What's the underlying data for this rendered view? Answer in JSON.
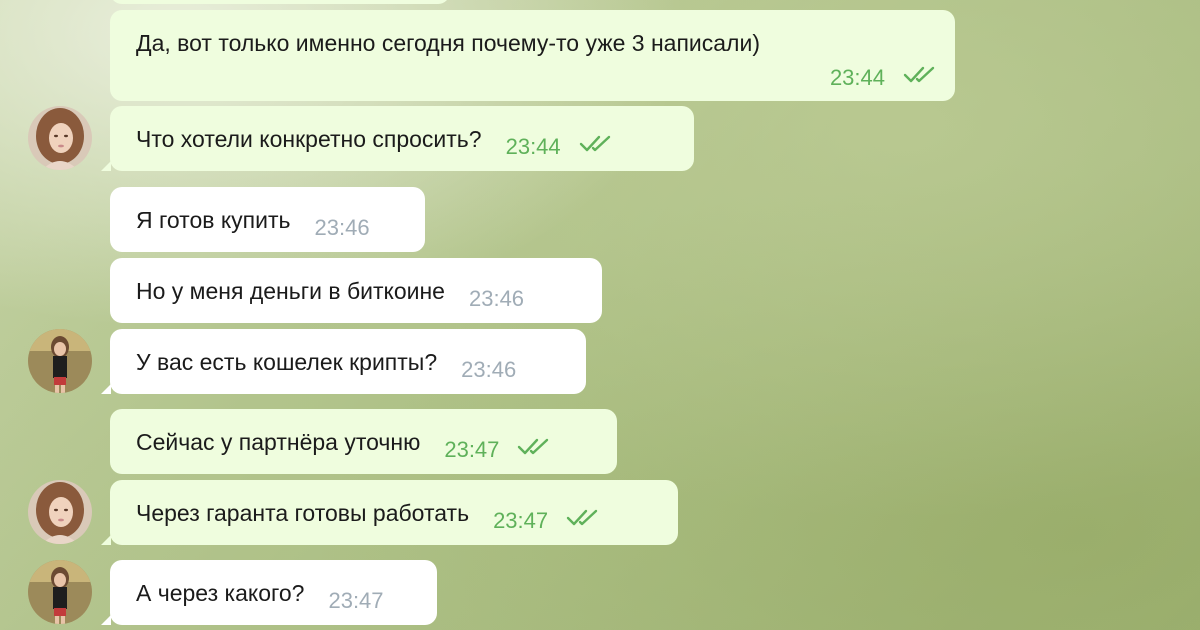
{
  "messages": [
    {
      "id": "m1",
      "direction": "out",
      "text": "Да, вот только именно сегодня почему-то уже 3 написали)",
      "time": "23:44",
      "read": true
    },
    {
      "id": "m2",
      "direction": "out",
      "text": "Что хотели конкретно спросить?",
      "time": "23:44",
      "read": true
    },
    {
      "id": "m3",
      "direction": "in",
      "text": "Я готов купить",
      "time": "23:46"
    },
    {
      "id": "m4",
      "direction": "in",
      "text": "Но у меня деньги в биткоине",
      "time": "23:46"
    },
    {
      "id": "m5",
      "direction": "in",
      "text": "У вас есть кошелек крипты?",
      "time": "23:46"
    },
    {
      "id": "m6",
      "direction": "out",
      "text": "Сейчас у партнёра уточню",
      "time": "23:47",
      "read": true
    },
    {
      "id": "m7",
      "direction": "out",
      "text": "Через гаранта готовы работать",
      "time": "23:47",
      "read": true
    },
    {
      "id": "m8",
      "direction": "in",
      "text": "А через какого?",
      "time": "23:47"
    }
  ],
  "colors": {
    "outgoing_bubble": "#effdde",
    "incoming_bubble": "#ffffff",
    "outgoing_time": "#5fb15a",
    "incoming_time": "#a0acb6",
    "read_checks": "#5fb15a"
  }
}
